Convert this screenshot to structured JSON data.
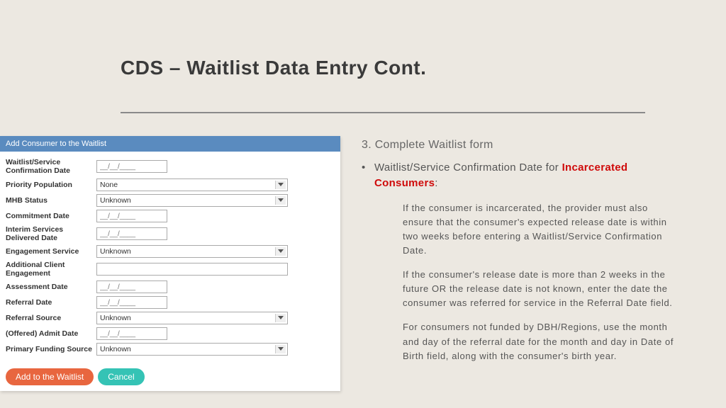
{
  "title": "CDS – Waitlist Data Entry Cont.",
  "form": {
    "header": "Add Consumer to the Waitlist",
    "date_placeholder": "__/__/____",
    "labels": {
      "waitlist_date": "Waitlist/Service Confirmation Date",
      "priority": "Priority Population",
      "mhb": "MHB Status",
      "commitment": "Commitment Date",
      "interim": "Interim Services Delivered Date",
      "engagement": "Engagement Service",
      "additional": "Additional Client Engagement",
      "assessment": "Assessment Date",
      "referral_date": "Referral Date",
      "referral_source": "Referral Source",
      "admit": "(Offered) Admit Date",
      "funding": "Primary Funding Source"
    },
    "selects": {
      "priority": "None",
      "mhb": "Unknown",
      "engagement": "Unknown",
      "referral_source": "Unknown",
      "funding": "Unknown"
    },
    "buttons": {
      "add": "Add to the Waitlist",
      "cancel": "Cancel"
    }
  },
  "right": {
    "step": "3. Complete Waitlist form",
    "bullet_lead": "Waitlist/Service Confirmation Date for ",
    "bullet_highlight": "Incarcerated Consumers",
    "bullet_tail": ":",
    "p1": "If the consumer is incarcerated, the provider must also ensure that the consumer's expected release date is within two weeks before entering a Waitlist/Service Confirmation Date.",
    "p2": "If the consumer's release date is more than 2 weeks in the future OR the release date is not known, enter the date the consumer was referred for service in the Referral Date field.",
    "p3": "For consumers not funded by DBH/Regions, use the month and day of the referral date for the month and day in Date of Birth field, along with the consumer's birth year."
  }
}
